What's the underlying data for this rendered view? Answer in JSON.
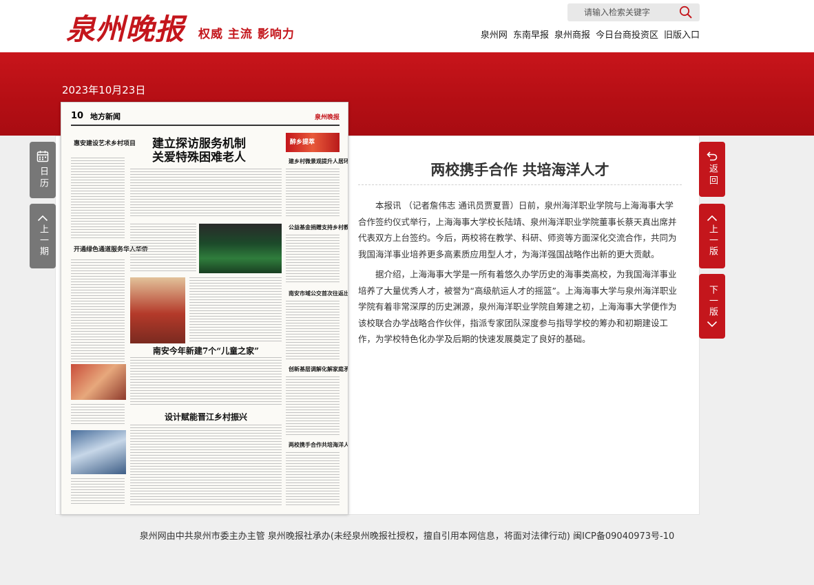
{
  "header": {
    "logo_text": "泉州晚报",
    "slogan": "权威 主流 影响力",
    "search": {
      "placeholder": "请输入检索关键字"
    },
    "nav": [
      "泉州网",
      "东南早报",
      "泉州商报",
      "今日台商投资区",
      "旧版入口"
    ]
  },
  "issue_date": "2023年10月23日",
  "left_buttons": {
    "calendar": "日历",
    "prev_issue": "上一期"
  },
  "right_buttons": {
    "back": "返回",
    "prev_page": "上一版",
    "next_page": "下一版"
  },
  "newspaper_page": {
    "page_number": "10",
    "section": "地方新闻",
    "masthead": "泉州晚报",
    "headlines": [
      "建立探访服务机制",
      "关爱特殊困难老人",
      "南安今年新建7个“儿童之家”",
      "设计赋能晋江乡村振兴"
    ],
    "side_headlines": [
      "惠安建设艺术乡村项目",
      "开通绿色通道服务华人华侨",
      "建乡村微景观提升人居环境",
      "公益基金捐赠支持乡村教育",
      "南安市域公交首次往返出试",
      "创新基层调解化解家庭矛盾",
      "两校携手合作共培海洋人才"
    ],
    "banner": "醉乡提萃"
  },
  "article": {
    "title": "两校携手合作 共培海洋人才",
    "paragraphs": [
      "本报讯 （记者詹伟志 通讯员贾夏晋）日前，泉州海洋职业学院与上海海事大学合作签约仪式举行，上海海事大学校长陆靖、泉州海洋职业学院董事长蔡天真出席并代表双方上台签约。今后，两校将在教学、科研、师资等方面深化交流合作，共同为我国海洋事业培养更多高素质应用型人才，为海洋强国战略作出新的更大贡献。",
      "据介绍，上海海事大学是一所有着悠久办学历史的海事类高校，为我国海洋事业培养了大量优秀人才，被誉为“高级航运人才的摇篮”。上海海事大学与泉州海洋职业学院有着非常深厚的历史渊源，泉州海洋职业学院自筹建之初，上海海事大学便作为该校联合办学战略合作伙伴，指派专家团队深度参与指导学校的筹办和初期建设工作，为学校特色化办学及后期的快速发展奠定了良好的基础。"
    ]
  },
  "footer": "泉州网由中共泉州市委主办主管 泉州晚报社承办(未经泉州晚报社授权，擅自引用本网信息，将面对法律行动) 闽ICP备09040973号-10",
  "colors": {
    "brand_red": "#c4161c",
    "button_gray": "#777777",
    "page_bg": "#efefef"
  },
  "icons": [
    "search-icon",
    "calendar-icon",
    "chevron-up-icon",
    "back-arrow-icon",
    "chevron-down-icon"
  ]
}
